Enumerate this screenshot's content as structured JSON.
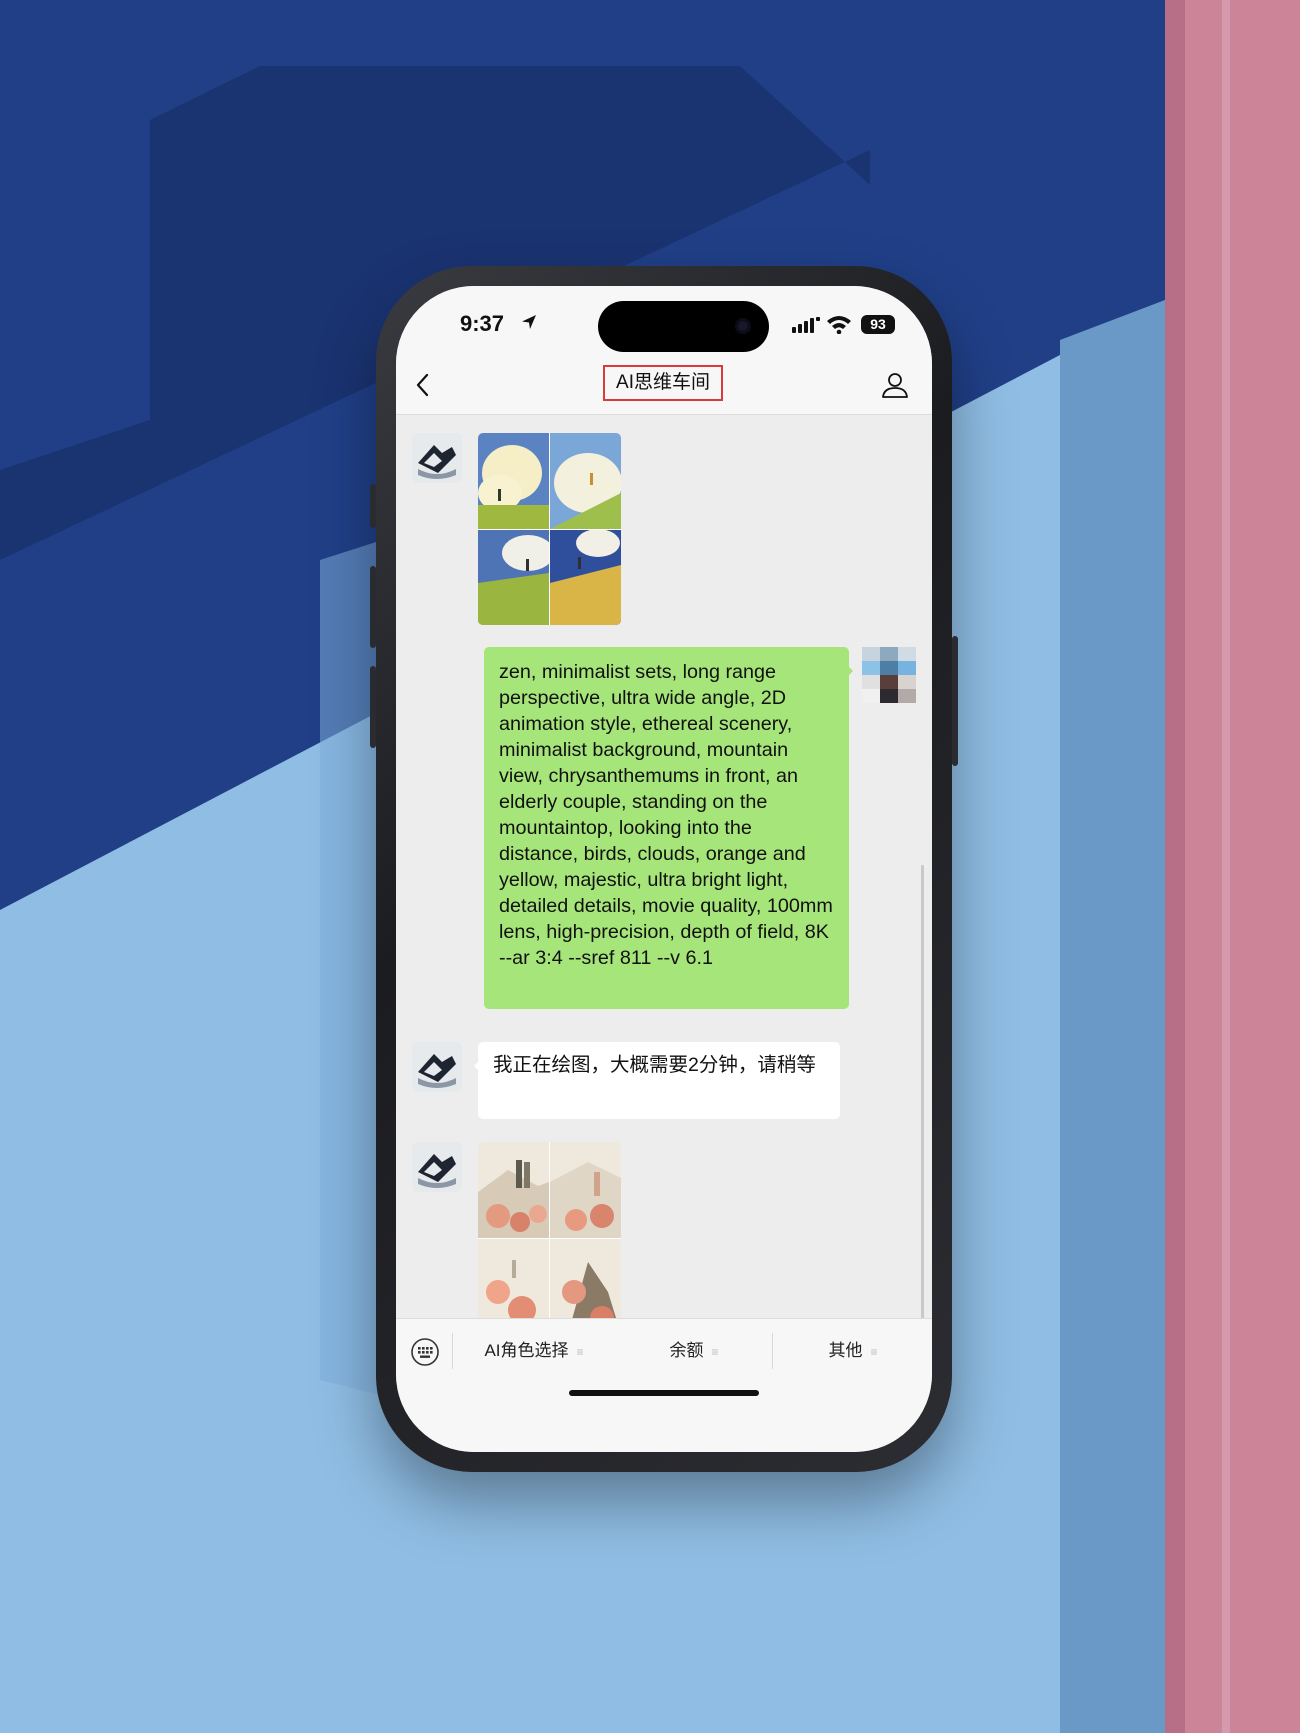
{
  "status_bar": {
    "time": "9:37",
    "battery": "93"
  },
  "nav": {
    "title": "AI思维车间"
  },
  "messages": {
    "user_prompt": "zen, minimalist sets, long range perspective, ultra wide angle, 2D animation style, ethereal scenery, minimalist background, mountain view, chrysanthemums in front, an elderly couple, standing on the mountaintop, looking into the distance, birds, clouds, orange and yellow, majestic, ultra bright light, detailed details, movie quality, 100mm lens, high-precision, depth of field, 8K --ar 3:4 --sref 811 --v 6.1",
    "bot_reply": "我正在绘图，大概需要2分钟，请稍等"
  },
  "menu": {
    "items": [
      "AI角色选择",
      "余额",
      "其他"
    ],
    "item_icon": "≡"
  },
  "colors": {
    "accent_green": "#a6e579",
    "title_highlight": "#d93a3a",
    "chat_bg": "#ededed"
  }
}
